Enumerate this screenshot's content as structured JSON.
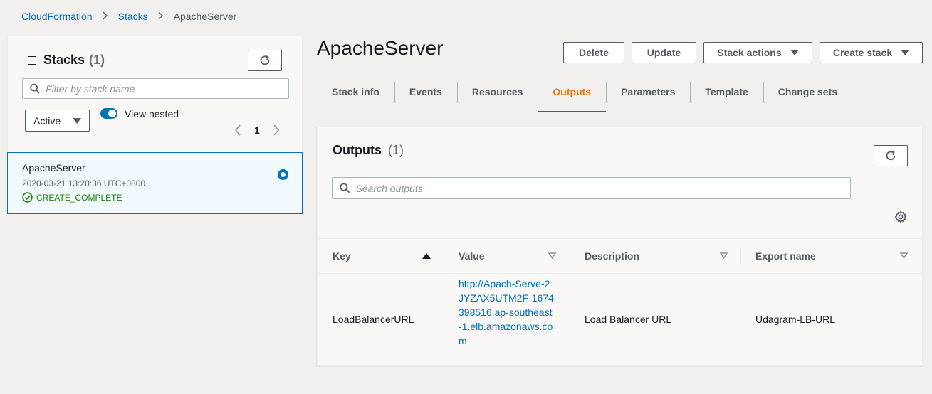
{
  "breadcrumb": {
    "items": [
      "CloudFormation",
      "Stacks"
    ],
    "current": "ApacheServer"
  },
  "stacks_panel": {
    "title": "Stacks",
    "count": "(1)",
    "search_placeholder": "Filter by stack name",
    "filter_selected": "Active",
    "toggle_label": "View nested",
    "toggle_on": true,
    "page": "1",
    "items": [
      {
        "name": "ApacheServer",
        "date": "2020-03-21 13:20:36 UTC+0800",
        "status": "CREATE_COMPLETE",
        "selected": true
      }
    ]
  },
  "header": {
    "title": "ApacheServer",
    "buttons": {
      "delete": "Delete",
      "update": "Update",
      "stack_actions": "Stack actions",
      "create_stack": "Create stack"
    }
  },
  "tabs": [
    "Stack info",
    "Events",
    "Resources",
    "Outputs",
    "Parameters",
    "Template",
    "Change sets"
  ],
  "active_tab": "Outputs",
  "outputs_panel": {
    "title": "Outputs",
    "count": "(1)",
    "search_placeholder": "Search outputs",
    "columns": [
      "Key",
      "Value",
      "Description",
      "Export name"
    ],
    "rows": [
      {
        "key": "LoadBalancerURL",
        "value": "http://Apach-Serve-2JYZAX5UTM2F-1674398516.ap-southeast-1.elb.amazonaws.com",
        "description": "Load Balancer URL",
        "export_name": "Udagram-LB-URL"
      }
    ]
  },
  "colors": {
    "accent_blue": "#0073bb",
    "active_tab_orange": "#ec7211",
    "success_green": "#1d8102"
  }
}
